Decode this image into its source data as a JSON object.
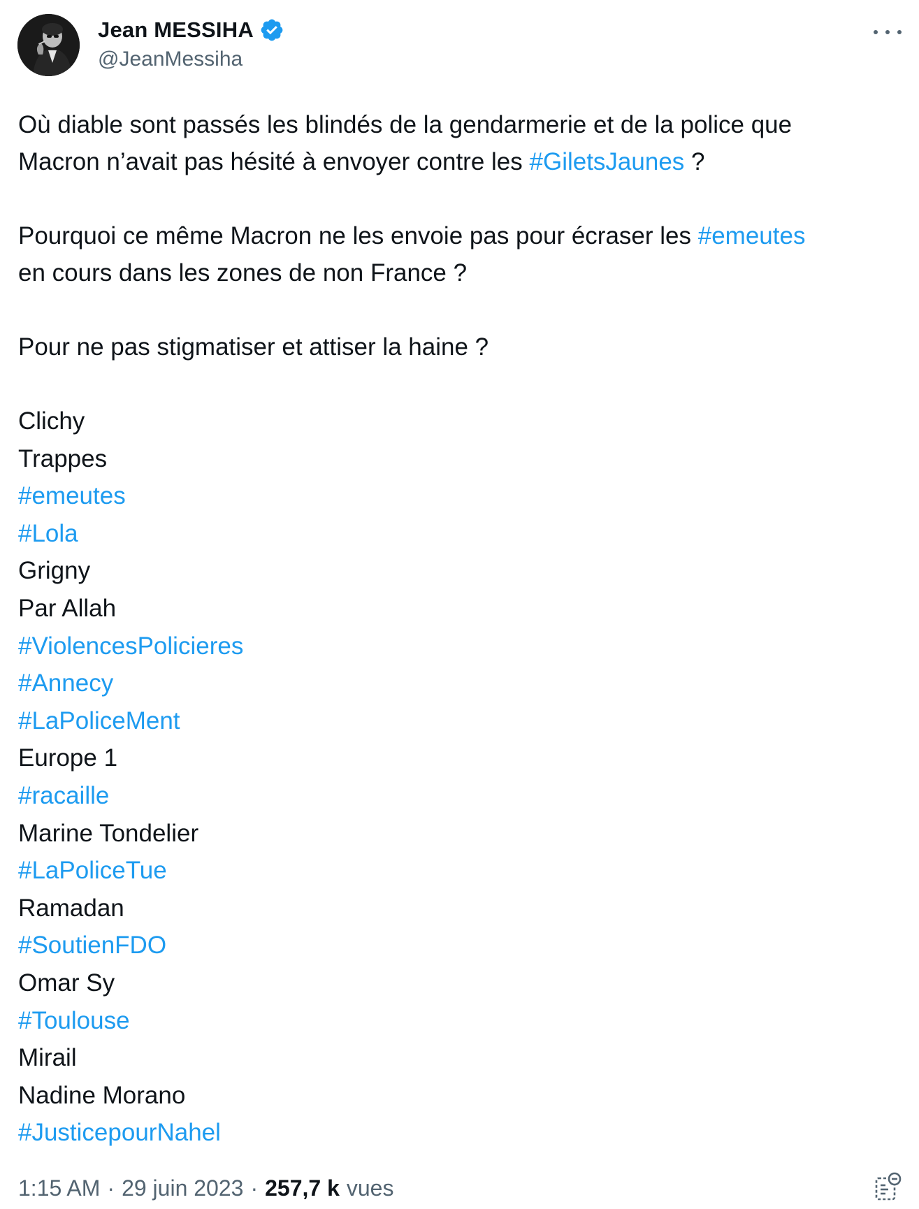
{
  "author": {
    "display_name": "Jean MESSIHA",
    "handle": "@JeanMessiha",
    "verified_icon": "verified-badge-icon",
    "avatar": "avatar-photo"
  },
  "colors": {
    "hashtag": "#1d9bf0",
    "text": "#0f1419",
    "secondary": "#536471",
    "verified": "#1d9bf0"
  },
  "tweet": {
    "para1_text1": "Où diable sont passés les blindés de la gendarmerie et de la police que",
    "para1_text2": "Macron n’avait pas hésité à envoyer contre les ",
    "para1_tag": "#GiletsJaunes",
    "para1_text3": " ?",
    "para2_text1": "Pourquoi ce même Macron ne les envoie pas pour écraser les ",
    "para2_tag": "#emeutes",
    "para2_text2": "en cours dans les zones de non France ?",
    "para3": "Pour ne pas stigmatiser et attiser la haine ?",
    "list": [
      {
        "text": "Clichy",
        "is_tag": false
      },
      {
        "text": "Trappes",
        "is_tag": false
      },
      {
        "text": "#emeutes",
        "is_tag": true
      },
      {
        "text": "#Lola",
        "is_tag": true
      },
      {
        "text": "Grigny",
        "is_tag": false
      },
      {
        "text": "Par Allah",
        "is_tag": false
      },
      {
        "text": "#ViolencesPolicieres",
        "is_tag": true
      },
      {
        "text": "#Annecy",
        "is_tag": true
      },
      {
        "text": "#LaPoliceMent",
        "is_tag": true
      },
      {
        "text": "Europe 1",
        "is_tag": false
      },
      {
        "text": "#racaille",
        "is_tag": true
      },
      {
        "text": "Marine Tondelier",
        "is_tag": false
      },
      {
        "text": "#LaPoliceTue",
        "is_tag": true
      },
      {
        "text": "Ramadan",
        "is_tag": false
      },
      {
        "text": "#SoutienFDO",
        "is_tag": true
      },
      {
        "text": "Omar Sy",
        "is_tag": false
      },
      {
        "text": "#Toulouse",
        "is_tag": true
      },
      {
        "text": "Mirail",
        "is_tag": false
      },
      {
        "text": "Nadine Morano",
        "is_tag": false
      },
      {
        "text": "#JusticepourNahel",
        "is_tag": true
      }
    ]
  },
  "meta": {
    "time": "1:15 AM",
    "separator": "·",
    "date": "29 juin 2023",
    "views_count": "257,7 k",
    "views_label": "vues"
  }
}
